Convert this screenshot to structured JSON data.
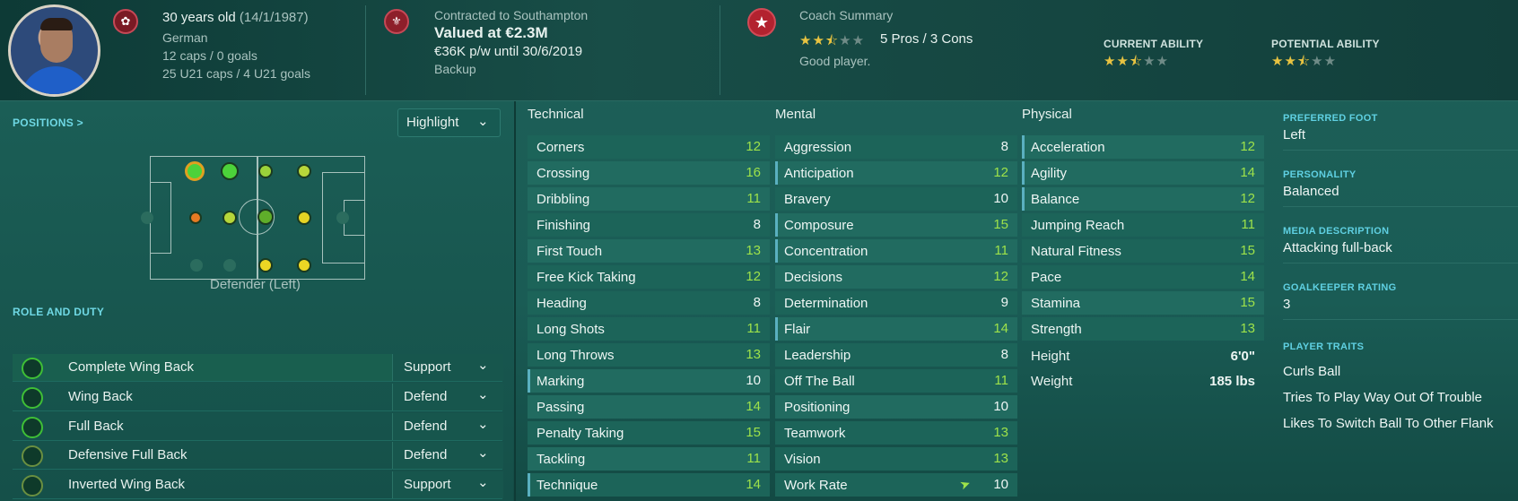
{
  "header": {
    "age": "30 years old",
    "dob": "(14/1/1987)",
    "nationality": "German",
    "caps": "12 caps / 0 goals",
    "u21caps": "25 U21 caps / 4 U21 goals",
    "club_line": "Contracted to Southampton",
    "value": "Valued at €2.3M",
    "wage": "€36K p/w until 30/6/2019",
    "squad_status": "Backup",
    "coach_title": "Coach Summary",
    "coach_rating_stars": 2.5,
    "pros_cons": "5 Pros / 3 Cons",
    "coach_text": "Good player.",
    "current_ability_label": "CURRENT ABILITY",
    "current_ability_stars": 2.5,
    "potential_ability_label": "POTENTIAL ABILITY",
    "potential_ability_stars": 2.5
  },
  "positions": {
    "title": "POSITIONS >",
    "dropdown": "Highlight",
    "caption": "Defender (Left)"
  },
  "role_section_title": "ROLE AND DUTY",
  "roles": [
    {
      "name": "Complete Wing Back",
      "duty": "Support"
    },
    {
      "name": "Wing Back",
      "duty": "Defend"
    },
    {
      "name": "Full Back",
      "duty": "Defend"
    },
    {
      "name": "Defensive Full Back",
      "duty": "Defend"
    },
    {
      "name": "Inverted Wing Back",
      "duty": "Support"
    }
  ],
  "technical": {
    "title": "Technical",
    "rows": [
      {
        "name": "Corners",
        "value": "12"
      },
      {
        "name": "Crossing",
        "value": "16"
      },
      {
        "name": "Dribbling",
        "value": "11"
      },
      {
        "name": "Finishing",
        "value": "8"
      },
      {
        "name": "First Touch",
        "value": "13"
      },
      {
        "name": "Free Kick Taking",
        "value": "12"
      },
      {
        "name": "Heading",
        "value": "8"
      },
      {
        "name": "Long Shots",
        "value": "11"
      },
      {
        "name": "Long Throws",
        "value": "13"
      },
      {
        "name": "Marking",
        "value": "10"
      },
      {
        "name": "Passing",
        "value": "14"
      },
      {
        "name": "Penalty Taking",
        "value": "15"
      },
      {
        "name": "Tackling",
        "value": "11"
      },
      {
        "name": "Technique",
        "value": "14"
      }
    ]
  },
  "mental": {
    "title": "Mental",
    "rows": [
      {
        "name": "Aggression",
        "value": "8"
      },
      {
        "name": "Anticipation",
        "value": "12"
      },
      {
        "name": "Bravery",
        "value": "10"
      },
      {
        "name": "Composure",
        "value": "15"
      },
      {
        "name": "Concentration",
        "value": "11"
      },
      {
        "name": "Decisions",
        "value": "12"
      },
      {
        "name": "Determination",
        "value": "9"
      },
      {
        "name": "Flair",
        "value": "14"
      },
      {
        "name": "Leadership",
        "value": "8"
      },
      {
        "name": "Off The Ball",
        "value": "11"
      },
      {
        "name": "Positioning",
        "value": "10"
      },
      {
        "name": "Teamwork",
        "value": "13"
      },
      {
        "name": "Vision",
        "value": "13"
      },
      {
        "name": "Work Rate",
        "value": "10"
      }
    ]
  },
  "physical": {
    "title": "Physical",
    "rows": [
      {
        "name": "Acceleration",
        "value": "12"
      },
      {
        "name": "Agility",
        "value": "14"
      },
      {
        "name": "Balance",
        "value": "12"
      },
      {
        "name": "Jumping Reach",
        "value": "11"
      },
      {
        "name": "Natural Fitness",
        "value": "15"
      },
      {
        "name": "Pace",
        "value": "14"
      },
      {
        "name": "Stamina",
        "value": "15"
      },
      {
        "name": "Strength",
        "value": "13"
      }
    ],
    "height_label": "Height",
    "height": "6'0\"",
    "weight_label": "Weight",
    "weight": "185 lbs"
  },
  "info": {
    "foot_label": "PREFERRED FOOT",
    "foot": "Left",
    "personality_label": "PERSONALITY",
    "personality": "Balanced",
    "media_label": "MEDIA DESCRIPTION",
    "media": "Attacking full-back",
    "gk_label": "GOALKEEPER RATING",
    "gk": "3",
    "traits_label": "PLAYER TRAITS",
    "traits": [
      "Curls Ball",
      "Tries To Play Way Out Of Trouble",
      "Likes To Switch Ball To Other Flank"
    ]
  }
}
